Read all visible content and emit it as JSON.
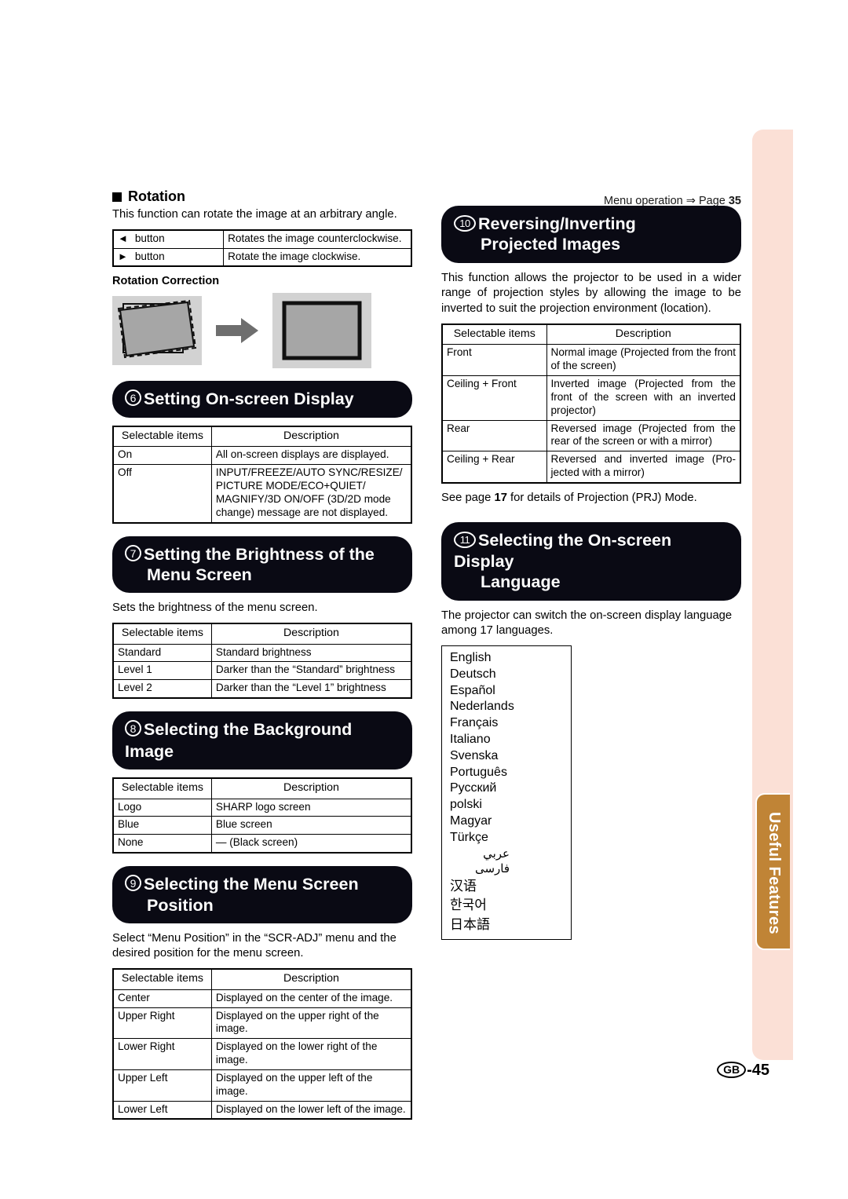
{
  "page": {
    "footer_locale": "GB",
    "footer_number": "-45",
    "side_tab_label": "Useful Features",
    "menu_operation_note": "Menu operation ",
    "menu_operation_arrow": "⇒",
    "menu_operation_page_label": " Page ",
    "menu_operation_page_number": "35"
  },
  "colors": {
    "banner_bg": "#0a0a14",
    "side_tab_strip": "#fbe0d6",
    "side_tab_chip": "#c08436",
    "figure_panel": "#d2d2d2",
    "figure_screen": "#a6a6a6"
  },
  "left_column": {
    "rotation": {
      "heading": "Rotation",
      "body": "This function can rotate the image at an arbitrary angle.",
      "table": {
        "rows": [
          {
            "icon": "◄",
            "item": "button",
            "desc": "Rotates the image counterclockwise."
          },
          {
            "icon": "►",
            "item": "button",
            "desc": "Rotate the image clockwise."
          }
        ]
      },
      "figure_caption": "Rotation Correction",
      "figure_before_name": "tilted-projected-image",
      "figure_after_name": "corrected-projected-image"
    },
    "section6": {
      "number": "6",
      "title": "Setting On-screen Display",
      "table": {
        "headers": [
          "Selectable items",
          "Description"
        ],
        "rows": [
          {
            "item": "On",
            "desc": "All on-screen displays are displayed."
          },
          {
            "item": "Off",
            "desc": "INPUT/FREEZE/AUTO SYNC/RESIZE/ PICTURE MODE/ECO+QUIET/ MAGNIFY/3D ON/OFF (3D/2D mode change) message are not displayed."
          }
        ]
      }
    },
    "section7": {
      "number": "7",
      "title_line1": "Setting the Brightness of the",
      "title_line2": "Menu Screen",
      "body": "Sets the brightness of the menu screen.",
      "table": {
        "headers": [
          "Selectable items",
          "Description"
        ],
        "rows": [
          {
            "item": "Standard",
            "desc": "Standard brightness"
          },
          {
            "item": "Level 1",
            "desc": "Darker than the “Standard” brightness"
          },
          {
            "item": "Level 2",
            "desc": "Darker than the “Level 1” brightness"
          }
        ]
      }
    },
    "section8": {
      "number": "8",
      "title": "Selecting the Background Image",
      "table": {
        "headers": [
          "Selectable items",
          "Description"
        ],
        "rows": [
          {
            "item": "Logo",
            "desc": "SHARP logo screen"
          },
          {
            "item": "Blue",
            "desc": "Blue screen"
          },
          {
            "item": "None",
            "desc": "— (Black screen)"
          }
        ]
      }
    },
    "section9": {
      "number": "9",
      "title_line1": "Selecting the Menu Screen",
      "title_line2": "Position",
      "body": "Select “Menu Position” in the “SCR-ADJ” menu and the desired position for the menu screen.",
      "table": {
        "headers": [
          "Selectable items",
          "Description"
        ],
        "rows": [
          {
            "item": "Center",
            "desc": "Displayed on the center of the image."
          },
          {
            "item": "Upper Right",
            "desc": "Displayed on the upper right of the image."
          },
          {
            "item": "Lower Right",
            "desc": "Displayed on the lower right of the image."
          },
          {
            "item": "Upper Left",
            "desc": "Displayed on the upper left of the image."
          },
          {
            "item": "Lower Left",
            "desc": "Displayed on the lower left of the image."
          }
        ]
      }
    }
  },
  "right_column": {
    "section10": {
      "number": "10",
      "title_line1": "Reversing/Inverting",
      "title_line2": "Projected Images",
      "body": "This function allows the projector to be used in a wider range of projection styles by allowing the image to be inverted to suit the projection environment (location).",
      "table": {
        "headers": [
          "Selectable items",
          "Description"
        ],
        "rows": [
          {
            "item": "Front",
            "desc": "Normal image (Projected from the front of the screen)"
          },
          {
            "item": "Ceiling + Front",
            "desc": "Inverted image (Projected from the front of the screen with an inverted projector)"
          },
          {
            "item": "Rear",
            "desc": "Reversed image (Projected from the rear of the screen or with a mirror)"
          },
          {
            "item": "Ceiling + Rear",
            "desc": "Reversed and inverted image (Pro-jected with a mirror)"
          }
        ]
      },
      "note_prefix": "See page ",
      "note_page": "17",
      "note_suffix": " for details of Projection (PRJ) Mode."
    },
    "section11": {
      "number": "11",
      "title_line1": "Selecting the On-screen Display",
      "title_line2": "Language",
      "body": "The projector can switch the on-screen display language among 17 languages.",
      "languages": [
        "English",
        "Deutsch",
        "Español",
        "Nederlands",
        "Français",
        "Italiano",
        "Svenska",
        "Português",
        "Русский",
        "polski",
        "Magyar",
        "Türkçe",
        "عربي",
        "فارسی",
        "汉语",
        "한국어",
        "日本語"
      ]
    }
  }
}
